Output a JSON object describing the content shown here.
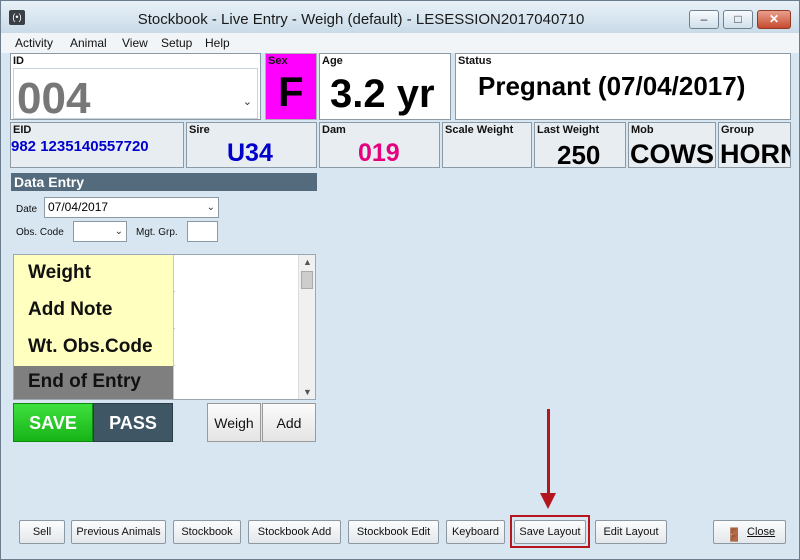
{
  "window": {
    "title": "Stockbook - Live Entry - Weigh (default) - LESESSION2017040710",
    "app_icon": "(•)",
    "min_glyph": "–",
    "max_glyph": "□",
    "close_glyph": "✕"
  },
  "menu": [
    "Activity",
    "Animal",
    "View",
    "Setup",
    "Help"
  ],
  "header": {
    "id": {
      "label": "ID",
      "value": "004"
    },
    "sex": {
      "label": "Sex",
      "value": "F",
      "color": "#ff00ff"
    },
    "age": {
      "label": "Age",
      "value": "3.2 yr"
    },
    "status": {
      "label": "Status",
      "value": "Pregnant (07/04/2017)"
    },
    "eid": {
      "label": "EID",
      "value": "982 1235140557720",
      "color": "#0000cc"
    },
    "sire": {
      "label": "Sire",
      "value": "U34",
      "color": "#0000cc"
    },
    "dam": {
      "label": "Dam",
      "value": "019",
      "color": "#e6007e"
    },
    "scale_weight": {
      "label": "Scale Weight",
      "value": ""
    },
    "last_weight": {
      "label": "Last Weight",
      "value": "250"
    },
    "mob": {
      "label": "Mob",
      "value": "COWS"
    },
    "group": {
      "label": "Group",
      "value": "HORN"
    }
  },
  "data_entry": {
    "title": "Data Entry",
    "date_label": "Date",
    "date_value": "07/04/2017",
    "obs_code_label": "Obs. Code",
    "obs_code_value": "",
    "mgt_grp_label": "Mgt. Grp.",
    "mgt_grp_value": "",
    "rows": [
      {
        "label": "Weight",
        "value": ""
      },
      {
        "label": "Add Note",
        "value": ""
      },
      {
        "label": "Wt. Obs.Code",
        "value": ""
      },
      {
        "label": "End of Entry",
        "value": ""
      }
    ],
    "save_label": "SAVE",
    "pass_label": "PASS",
    "weigh_label": "Weigh",
    "add_label": "Add"
  },
  "bottom_buttons": {
    "sell": "Sell",
    "previous_animals": "Previous Animals",
    "stockbook": "Stockbook",
    "stockbook_add": "Stockbook Add",
    "stockbook_edit": "Stockbook Edit",
    "keyboard": "Keyboard",
    "save_layout": "Save Layout",
    "edit_layout": "Edit Layout",
    "close": "Close"
  }
}
